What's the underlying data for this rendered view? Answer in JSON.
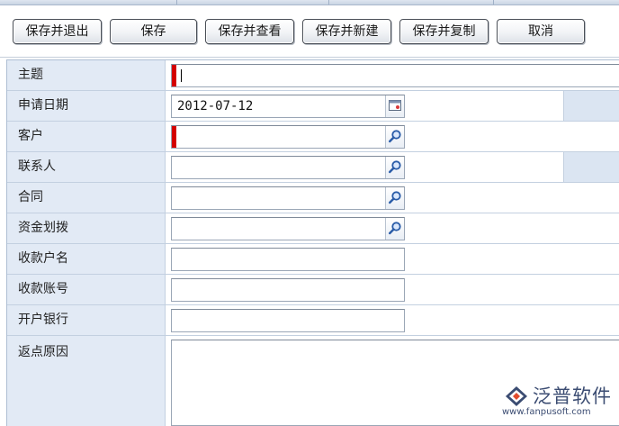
{
  "toolbar": {
    "buttons": [
      {
        "label": "保存并退出"
      },
      {
        "label": "保存"
      },
      {
        "label": "保存并查看"
      },
      {
        "label": "保存并新建"
      },
      {
        "label": "保存并复制"
      },
      {
        "label": "取消"
      }
    ]
  },
  "form": {
    "subject": {
      "label": "主题",
      "value": "",
      "required": true
    },
    "apply_date": {
      "label": "申请日期",
      "value": "2012-07-12"
    },
    "customer": {
      "label": "客户",
      "value": "",
      "required": true
    },
    "contact": {
      "label": "联系人",
      "value": ""
    },
    "contract": {
      "label": "合同",
      "value": ""
    },
    "fund_transfer": {
      "label": "资金划拨",
      "value": ""
    },
    "payee_name": {
      "label": "收款户名",
      "value": ""
    },
    "payee_account": {
      "label": "收款账号",
      "value": ""
    },
    "bank": {
      "label": "开户银行",
      "value": ""
    },
    "rebate_reason": {
      "label": "返点原因",
      "value": ""
    }
  },
  "icons": {
    "date_picker": "calendar-icon",
    "lookup": "magnifier-icon"
  },
  "logo": {
    "name": "泛普软件",
    "url": "www.fanpusoft.com"
  },
  "colors": {
    "label_bg": "#e2eaf5",
    "required_marker": "#d40000",
    "border": "#c3d0e0",
    "logo": "#3b4c72"
  }
}
